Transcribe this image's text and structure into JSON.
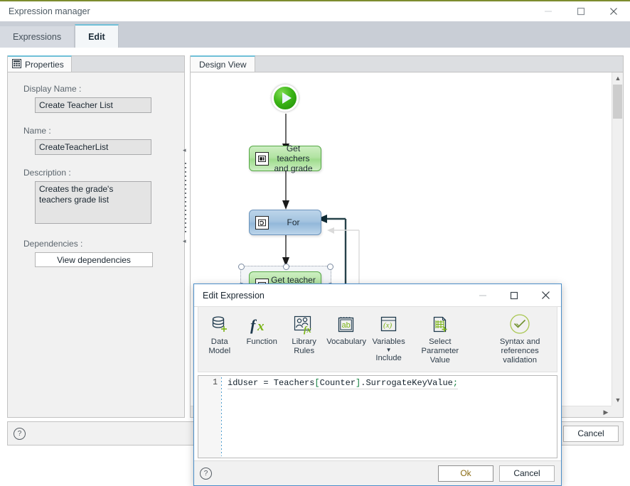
{
  "window": {
    "title": "Expression manager",
    "controls": {
      "minimize": "minimize-icon",
      "maximize": "maximize-icon",
      "close": "close-icon"
    }
  },
  "tabs": [
    {
      "label": "Expressions",
      "active": false
    },
    {
      "label": "Edit",
      "active": true
    }
  ],
  "properties_panel": {
    "tab_label": "Properties",
    "tab_icon": "properties-grid-icon",
    "fields": [
      {
        "label": "Display Name :",
        "value": "Create Teacher List"
      },
      {
        "label": "Name :",
        "value": "CreateTeacherList"
      },
      {
        "label": "Description :",
        "value": "Creates the grade's teachers grade list"
      },
      {
        "label": "Dependencies :",
        "value": "View dependencies"
      }
    ]
  },
  "design_view": {
    "tab_label": "Design View",
    "nodes": [
      {
        "type": "start",
        "label": ""
      },
      {
        "type": "task-green",
        "label": "Get teachers\nand grade",
        "icon": "task-screen-icon"
      },
      {
        "type": "loop-blue",
        "label": "For",
        "icon": "loop-icon"
      },
      {
        "type": "task-green-selected",
        "label": "Get teacher\nid",
        "icon": "task-screen-icon"
      }
    ]
  },
  "main_footer": {
    "help": "?",
    "cancel_label": "Cancel"
  },
  "dialog": {
    "title": "Edit Expression",
    "controls": {
      "minimize": "minimize-icon",
      "maximize": "maximize-icon",
      "close": "close-icon"
    },
    "ribbon": [
      {
        "id": "data-model",
        "line1": "Data",
        "line2": "Model",
        "icon": "database-plus-icon"
      },
      {
        "id": "function",
        "line1": "Function",
        "line2": "",
        "icon": "fx-icon"
      },
      {
        "id": "library-rules",
        "line1": "Library",
        "line2": "Rules",
        "icon": "people-fx-icon"
      },
      {
        "id": "vocabulary",
        "line1": "Vocabulary",
        "line2": "",
        "icon": "notepad-ab-icon"
      },
      {
        "id": "variables",
        "line1": "Variables",
        "line2": "",
        "icon": "variable-x-icon",
        "caret": true,
        "sublabel": "Include"
      },
      {
        "id": "select-parameter-value",
        "line1": "Select Parameter",
        "line2": "Value",
        "icon": "table-plus-icon"
      },
      {
        "id": "syntax-validation",
        "line1": "Syntax and references",
        "line2": "validation",
        "icon": "check-circle-icon"
      }
    ],
    "editor": {
      "line_number": "1",
      "code_prefix": "idUser = Teachers",
      "code_bracket_open": "[",
      "code_index": "Counter",
      "code_bracket_close": "]",
      "code_suffix": ".SurrogateKeyValue",
      "code_semicolon": ";",
      "full_text": "idUser = Teachers[Counter].SurrogateKeyValue;"
    },
    "footer": {
      "help": "?",
      "ok_label": "Ok",
      "cancel_label": "Cancel"
    }
  },
  "colors": {
    "accent_top": "#7d8c2e",
    "tab_active_underline": "#6fc0d8",
    "dialog_border": "#4b8ec9",
    "node_green": "#9fdc8d",
    "node_blue": "#93b8da",
    "icon_green": "#7ab317",
    "icon_navy": "#1f3a4d"
  }
}
